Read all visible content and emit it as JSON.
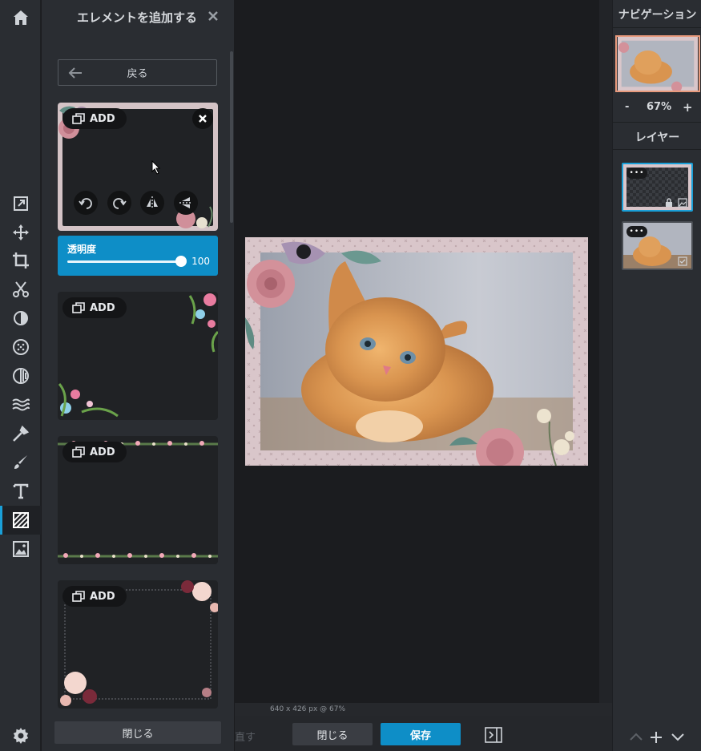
{
  "rail": {
    "tools": [
      "home-icon",
      "resize-icon",
      "move-icon",
      "crop-icon",
      "cutout-icon",
      "adjust-icon",
      "filter-icon",
      "effects-icon",
      "liquify-icon",
      "retouch-icon",
      "draw-icon",
      "text-icon",
      "elements-icon",
      "add-image-icon",
      "settings-icon"
    ],
    "active": "elements-icon"
  },
  "panel": {
    "title": "エレメントを追加する",
    "back_label": "戻る",
    "add_label": "ADD",
    "opacity_label": "透明度",
    "opacity_value": "100",
    "opacity_fraction": 1.0,
    "close_label": "閉じる"
  },
  "canvas": {
    "info": "640 x 426 px @ 67%"
  },
  "bottom": {
    "redo_label": "直す",
    "close_label": "閉じる",
    "save_label": "保存"
  },
  "right": {
    "navigation_title": "ナビゲーション",
    "zoom_minus": "-",
    "zoom_value": "67%",
    "zoom_plus": "+",
    "layers_title": "レイヤー",
    "layer_dots": "•••"
  },
  "colors": {
    "accent": "#0e8ec7",
    "frame_pink": "#d8c6c9"
  }
}
